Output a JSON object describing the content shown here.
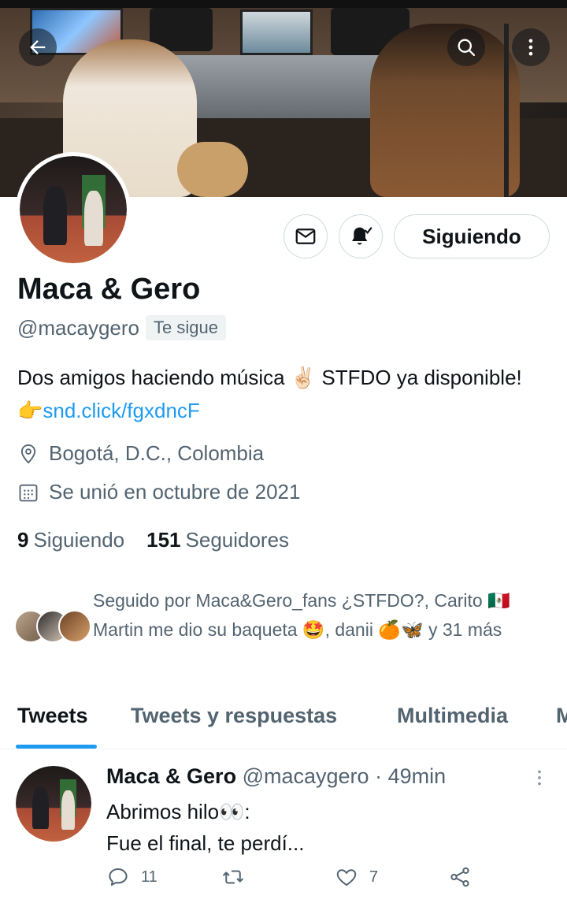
{
  "profile": {
    "name": "Maca & Gero",
    "handle": "@macaygero",
    "follows_you": "Te sigue",
    "bio_text": "Dos amigos haciendo música ✌🏻 STFDO ya disponible! 👉",
    "bio_link": "snd.click/fgxdncF",
    "location": "Bogotá, D.C., Colombia",
    "joined": "Se unió en octubre de 2021",
    "following_count": "9",
    "following_label": "Siguiendo",
    "followers_count": "151",
    "followers_label": "Seguidores",
    "followed_by": "Seguido por Maca&Gero_fans ¿STFDO?, Carito 🇲🇽 Martin me dio su baqueta 🤩, danii 🍊🦋 y 31 más"
  },
  "actions": {
    "follow_button": "Siguiendo",
    "dm_icon": "mail-icon",
    "notify_icon": "bell-check-icon"
  },
  "tabs": [
    {
      "label": "Tweets",
      "active": true
    },
    {
      "label": "Tweets y respuestas",
      "active": false
    },
    {
      "label": "Multimedia",
      "active": false
    },
    {
      "label": "M",
      "active": false
    }
  ],
  "tweet": {
    "author": "Maca & Gero",
    "handle": "@macaygero",
    "time": "· 49min",
    "line1": "Abrimos hilo👀:",
    "line2": "Fue el final, te perdí...",
    "reply_count": "11",
    "retweet_count": "",
    "like_count": "7"
  },
  "colors": {
    "accent": "#1d9bf0",
    "text_primary": "#0f1419",
    "text_secondary": "#536471",
    "border": "#cfd9de"
  }
}
